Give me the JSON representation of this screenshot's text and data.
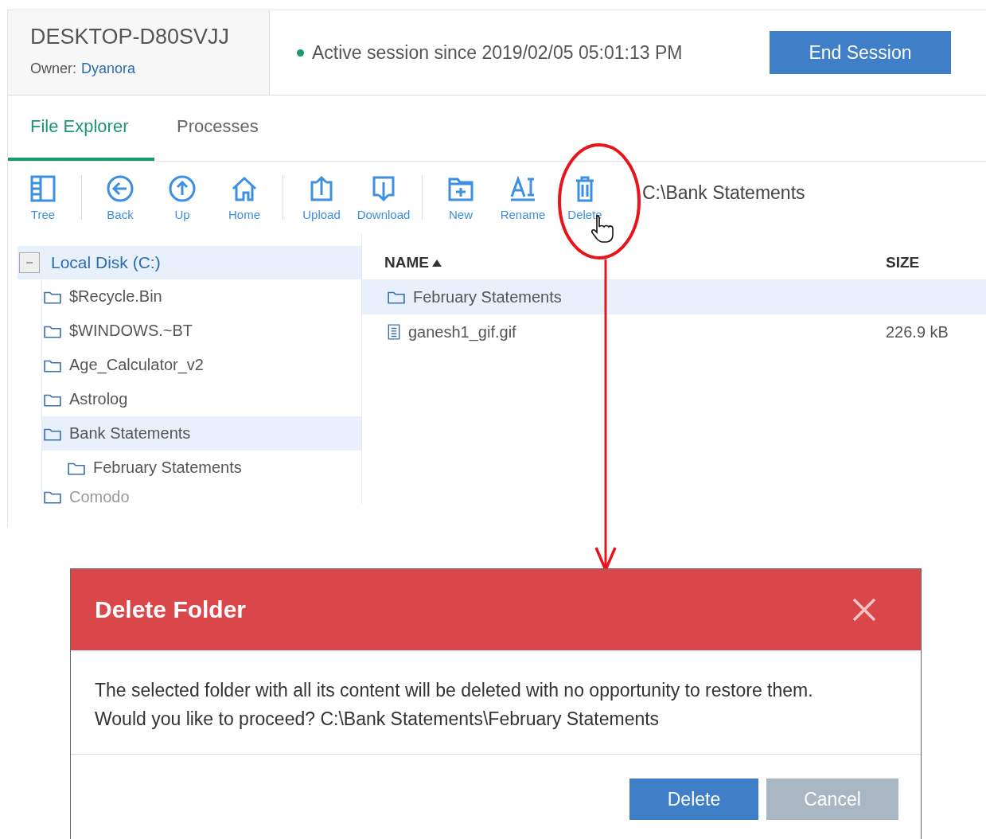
{
  "session": {
    "host": "DESKTOP-D80SVJJ",
    "owner_label": "Owner:",
    "owner": "Dyanora",
    "status": "Active session since 2019/02/05 05:01:13 PM",
    "end_button": "End Session"
  },
  "tabs": [
    {
      "label": "File Explorer",
      "selected": true
    },
    {
      "label": "Processes",
      "selected": false
    }
  ],
  "toolbar": [
    [
      {
        "label": "Tree",
        "kind": "tree"
      }
    ],
    [
      {
        "label": "Back",
        "kind": "back"
      },
      {
        "label": "Up",
        "kind": "up"
      },
      {
        "label": "Home",
        "kind": "home"
      }
    ],
    [
      {
        "label": "Upload",
        "kind": "upload"
      },
      {
        "label": "Download",
        "kind": "download"
      }
    ],
    [
      {
        "label": "New",
        "kind": "new"
      },
      {
        "label": "Rename",
        "kind": "rename"
      },
      {
        "label": "Delete",
        "kind": "delete"
      }
    ]
  ],
  "path": "C:\\Bank Statements",
  "tree": {
    "label": "Local Disk (C:)",
    "expanded": true,
    "children": [
      {
        "label": "$Recycle.Bin",
        "selected": false,
        "faded": false
      },
      {
        "label": "$WINDOWS.~BT",
        "selected": false,
        "faded": false
      },
      {
        "label": "Age_Calculator_v2",
        "selected": false,
        "faded": false
      },
      {
        "label": "Astrolog",
        "selected": false,
        "faded": false
      },
      {
        "label": "Bank Statements",
        "selected": true,
        "faded": false,
        "children": [
          {
            "label": "February Statements",
            "selected": false
          }
        ]
      },
      {
        "label": "Comodo",
        "selected": false,
        "faded": true
      }
    ]
  },
  "files": {
    "columns": [
      {
        "label": "NAME",
        "sorted": true
      },
      {
        "label": "SIZE",
        "sorted": false
      }
    ],
    "rows": [
      {
        "name": "February Statements",
        "kind": "folder",
        "size": "",
        "selected": true
      },
      {
        "name": "ganesh1_gif.gif",
        "kind": "file",
        "size": "226.9 kB",
        "selected": false
      }
    ]
  },
  "dialog": {
    "title": "Delete Folder",
    "lines": [
      "The selected folder with all its content will be deleted with no opportunity to restore them.",
      "Would you like to proceed? C:\\Bank Statements\\February Statements"
    ],
    "buttons": [
      {
        "label": "Delete",
        "kind": "primary"
      },
      {
        "label": "Cancel",
        "kind": "secondary"
      }
    ]
  }
}
